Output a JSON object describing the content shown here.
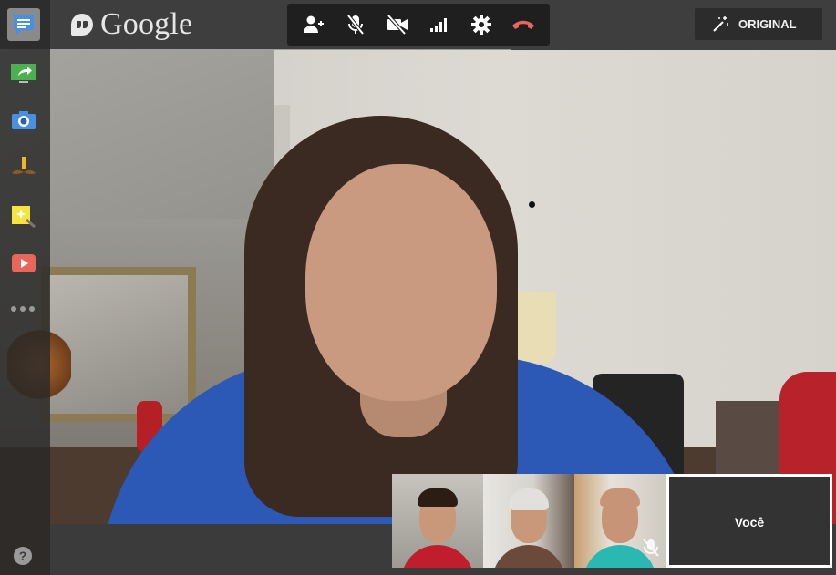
{
  "app": {
    "name": "Google",
    "product": "Hangouts"
  },
  "colors": {
    "hangup": "#e8675a",
    "topbar": "#3e3e3e",
    "controls_bg": "#1f1f1f"
  },
  "toolbar": {
    "controls": [
      {
        "id": "invite",
        "icon": "add-person-icon"
      },
      {
        "id": "mute-mic",
        "icon": "mic-off-icon"
      },
      {
        "id": "turn-off-camera",
        "icon": "camera-off-icon"
      },
      {
        "id": "bandwidth",
        "icon": "signal-bars-icon"
      },
      {
        "id": "settings",
        "icon": "gear-icon"
      },
      {
        "id": "hang-up",
        "icon": "phone-hangup-icon"
      }
    ],
    "effects_button": {
      "label": "ORIGINAL",
      "icon": "magic-wand-icon"
    }
  },
  "sidebar": {
    "apps": [
      {
        "id": "chat",
        "icon": "chat-icon",
        "active": true
      },
      {
        "id": "screenshare",
        "icon": "screenshare-icon"
      },
      {
        "id": "capture",
        "icon": "camera-icon"
      },
      {
        "id": "effects",
        "icon": "mustache-icon"
      },
      {
        "id": "effects-wand",
        "icon": "sparkle-icon"
      },
      {
        "id": "youtube",
        "icon": "youtube-icon"
      }
    ],
    "more": "more-apps-icon",
    "help": "?"
  },
  "filmstrip": {
    "participants": [
      {
        "id": "participant-1",
        "muted": false
      },
      {
        "id": "participant-2",
        "muted": false
      },
      {
        "id": "participant-3",
        "muted": true
      }
    ],
    "self_label": "Você"
  }
}
